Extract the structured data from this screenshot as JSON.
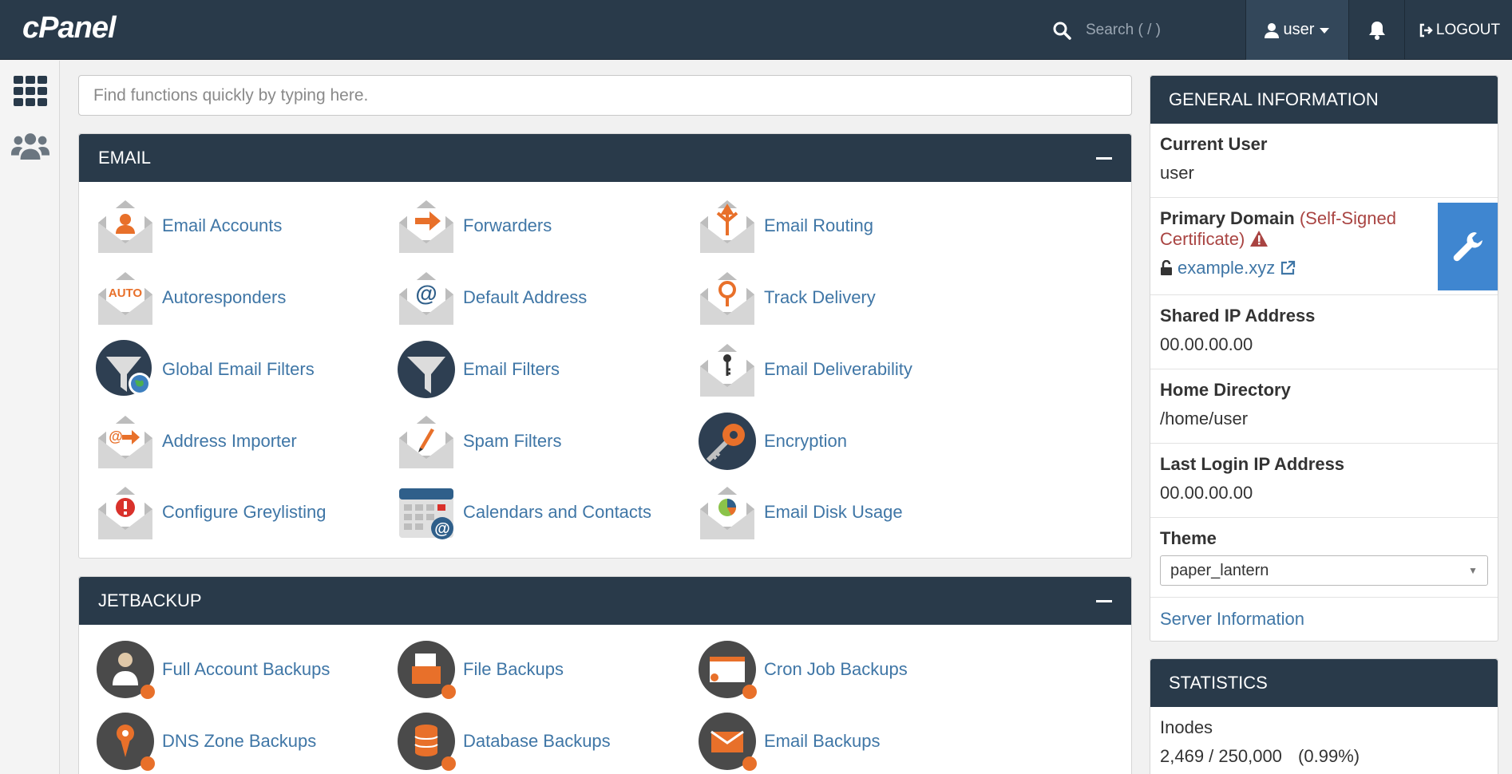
{
  "topbar": {
    "logo": "cPanel",
    "search_placeholder": "Search ( / )",
    "user_label": "user",
    "logout_label": "LOGOUT"
  },
  "function_search": {
    "placeholder": "Find functions quickly by typing here."
  },
  "email_panel": {
    "title": "EMAIL",
    "items": [
      {
        "label": "Email Accounts",
        "icon": "email-accounts-icon"
      },
      {
        "label": "Forwarders",
        "icon": "forwarders-icon"
      },
      {
        "label": "Email Routing",
        "icon": "email-routing-icon"
      },
      {
        "label": "Autoresponders",
        "icon": "autoresponders-icon",
        "badge": "AUTO"
      },
      {
        "label": "Default Address",
        "icon": "default-address-icon"
      },
      {
        "label": "Track Delivery",
        "icon": "track-delivery-icon"
      },
      {
        "label": "Global Email Filters",
        "icon": "global-email-filters-icon"
      },
      {
        "label": "Email Filters",
        "icon": "email-filters-icon"
      },
      {
        "label": "Email Deliverability",
        "icon": "email-deliverability-icon"
      },
      {
        "label": "Address Importer",
        "icon": "address-importer-icon"
      },
      {
        "label": "Spam Filters",
        "icon": "spam-filters-icon"
      },
      {
        "label": "Encryption",
        "icon": "encryption-icon"
      },
      {
        "label": "Configure Greylisting",
        "icon": "greylisting-icon"
      },
      {
        "label": "Calendars and Contacts",
        "icon": "calendars-contacts-icon"
      },
      {
        "label": "Email Disk Usage",
        "icon": "email-disk-usage-icon"
      }
    ]
  },
  "jetbackup_panel": {
    "title": "JETBACKUP",
    "items": [
      {
        "label": "Full Account Backups",
        "icon": "full-account-backups-icon"
      },
      {
        "label": "File Backups",
        "icon": "file-backups-icon"
      },
      {
        "label": "Cron Job Backups",
        "icon": "cron-job-backups-icon"
      },
      {
        "label": "DNS Zone Backups",
        "icon": "dns-zone-backups-icon"
      },
      {
        "label": "Database Backups",
        "icon": "database-backups-icon"
      },
      {
        "label": "Email Backups",
        "icon": "email-backups-icon"
      }
    ]
  },
  "general_info": {
    "title": "GENERAL INFORMATION",
    "current_user_label": "Current User",
    "current_user": "user",
    "primary_domain_label": "Primary Domain",
    "cert_warning": "(Self-Signed Certificate)",
    "domain": "example.xyz",
    "shared_ip_label": "Shared IP Address",
    "shared_ip": "00.00.00.00",
    "home_dir_label": "Home Directory",
    "home_dir": "/home/user",
    "last_login_label": "Last Login IP Address",
    "last_login": "00.00.00.00",
    "theme_label": "Theme",
    "theme_value": "paper_lantern",
    "server_info_link": "Server Information"
  },
  "statistics": {
    "title": "STATISTICS",
    "inodes_label": "Inodes",
    "inodes_value": "2,469 / 250,000",
    "inodes_percent": "(0.99%)"
  },
  "colors": {
    "navy": "#293a4a",
    "link": "#3f76a6",
    "orange": "#e8702a",
    "warning": "#a94442",
    "accent_blue": "#3f86d0"
  }
}
